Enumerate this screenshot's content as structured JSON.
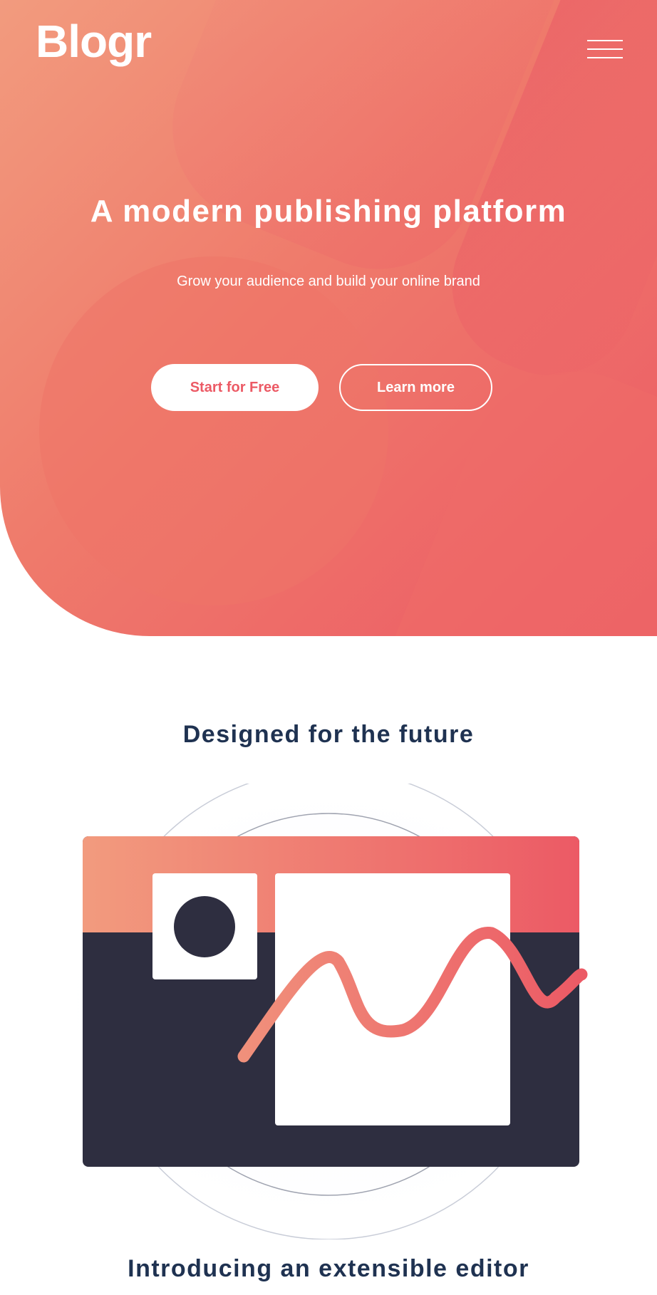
{
  "header": {
    "logo": "Blogr",
    "menu_icon": "hamburger-menu-icon"
  },
  "hero": {
    "title": "A modern publishing platform",
    "subtitle": "Grow your audience and build your online brand",
    "primary_button": "Start for Free",
    "secondary_button": "Learn more"
  },
  "future": {
    "title": "Designed for the future",
    "illustration": "editor-illustration"
  },
  "editor": {
    "title": "Introducing an extensible editor"
  },
  "colors": {
    "accent": "#ec5a65",
    "gradient_start": "#f29b7e",
    "gradient_end": "#ec5a65",
    "heading": "#1f3251",
    "dark_panel": "#2e2e40"
  }
}
